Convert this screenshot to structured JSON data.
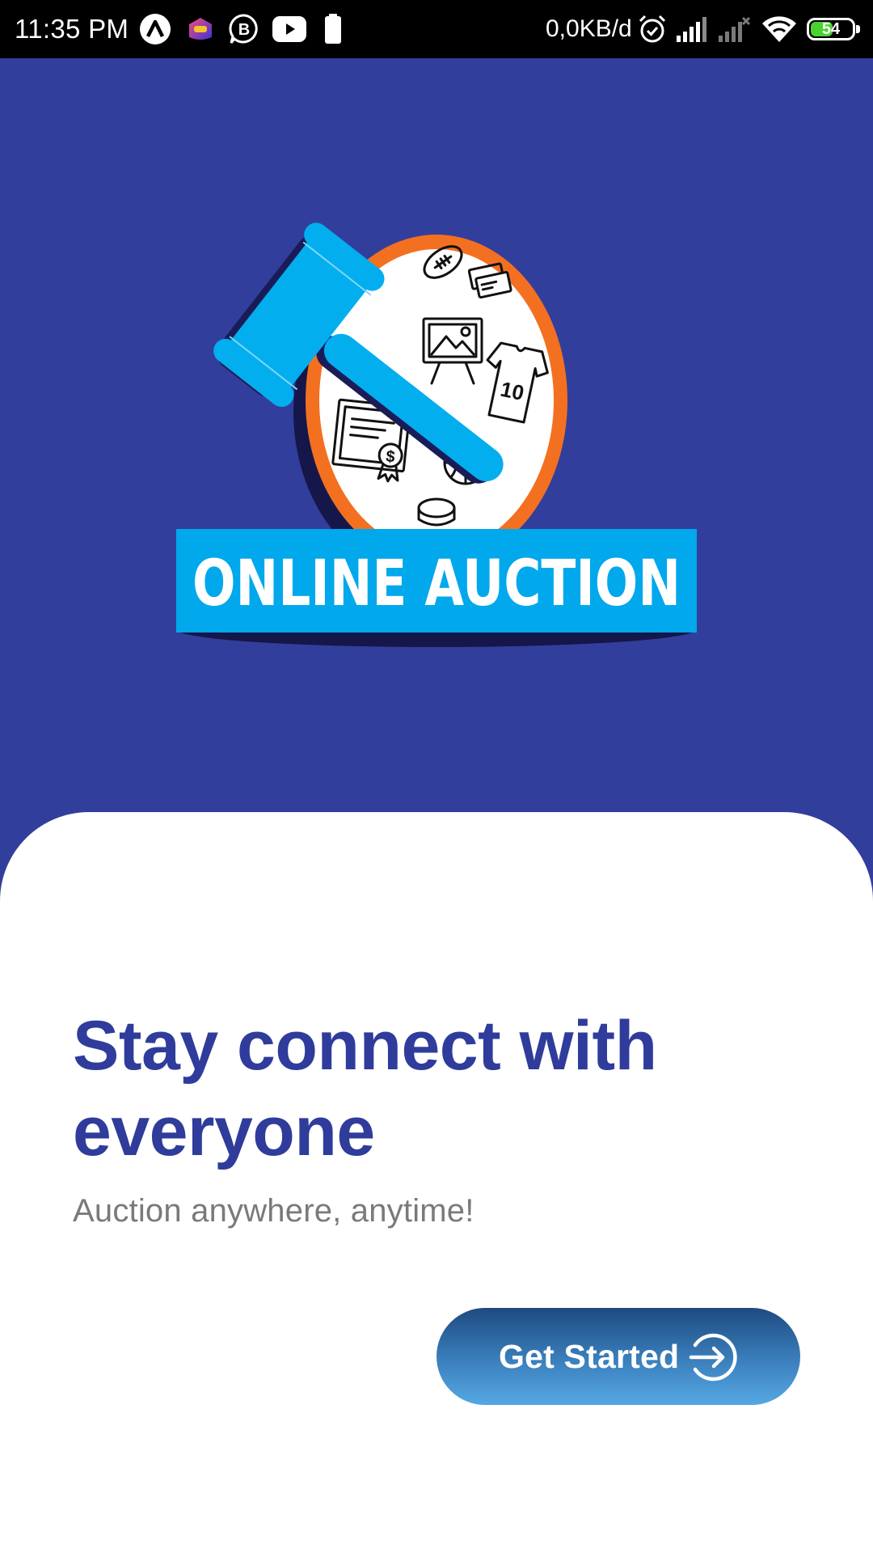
{
  "status_bar": {
    "time": "11:35 PM",
    "data_rate": "0,0KB/d",
    "battery_level": "54",
    "battery_fraction": 0.54,
    "icons": [
      "app-a-icon",
      "lazada-icon",
      "b-messenger-icon",
      "youtube-icon",
      "battery-saver-icon",
      "alarm-icon",
      "signal-icon",
      "no-signal-icon",
      "wifi-icon",
      "battery-icon"
    ]
  },
  "logo": {
    "text": "ONLINE AUCTION",
    "jersey_number": "10",
    "currency_symbol": "$"
  },
  "content": {
    "headline": "Stay connect with everyone",
    "subtitle": "Auction anywhere, anytime!"
  },
  "cta": {
    "label": "Get Started",
    "icon": "arrow-right-circle-icon"
  },
  "colors": {
    "hero_background": "#323e9c",
    "headline": "#2f3c9b",
    "subtitle": "#7a7a7a",
    "logo_banner": "#01a8ec",
    "logo_ring": "#f37021",
    "gavel": "#03aeef",
    "button_top": "#1e4a80",
    "button_bottom": "#55a8e4"
  }
}
